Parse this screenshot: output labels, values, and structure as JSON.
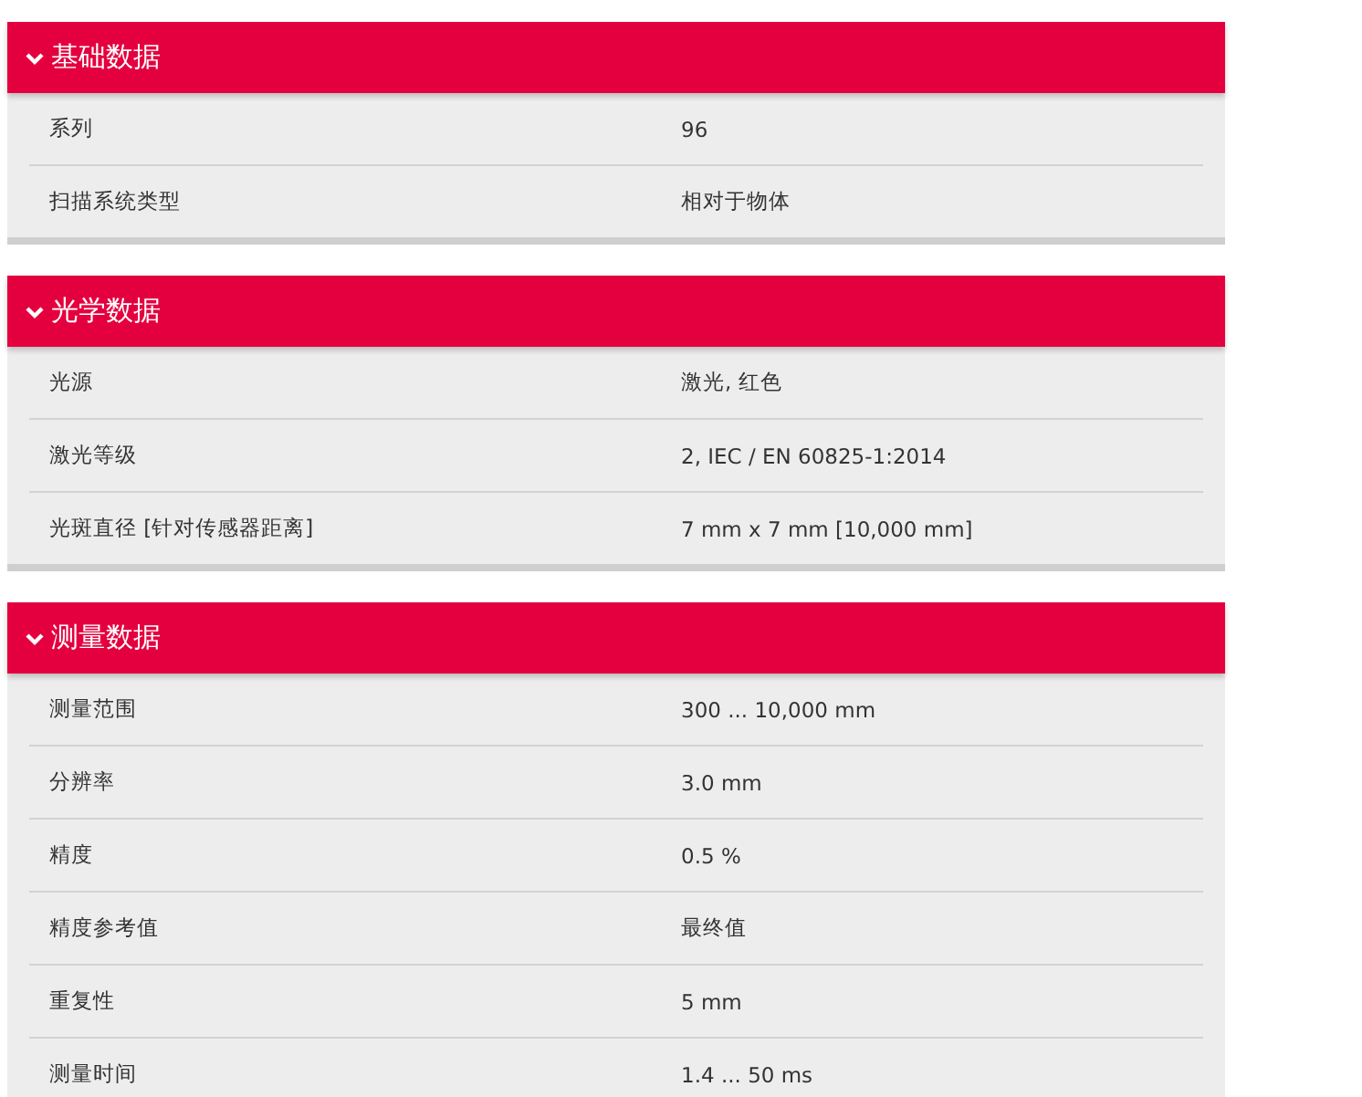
{
  "sections": [
    {
      "title": "基础数据",
      "expanded": true,
      "rows": [
        {
          "label": "系列",
          "value": "96"
        },
        {
          "label": "扫描系统类型",
          "value": "相对于物体"
        }
      ]
    },
    {
      "title": "光学数据",
      "expanded": true,
      "rows": [
        {
          "label": "光源",
          "value": "激光, 红色"
        },
        {
          "label": "激光等级",
          "value": "2, IEC / EN 60825-1:2014"
        },
        {
          "label": "光斑直径 [针对传感器距离]",
          "value": "7 mm x 7 mm [10,000 mm]"
        }
      ]
    },
    {
      "title": "测量数据",
      "expanded": true,
      "rows": [
        {
          "label": "测量范围",
          "value": "300 ... 10,000 mm"
        },
        {
          "label": "分辨率",
          "value": "3.0 mm"
        },
        {
          "label": "精度",
          "value": "0.5 %"
        },
        {
          "label": "精度参考值",
          "value": "最终值"
        },
        {
          "label": "重复性",
          "value": "5 mm"
        },
        {
          "label": "测量时间",
          "value": "1.4 ... 50 ms"
        }
      ]
    }
  ]
}
